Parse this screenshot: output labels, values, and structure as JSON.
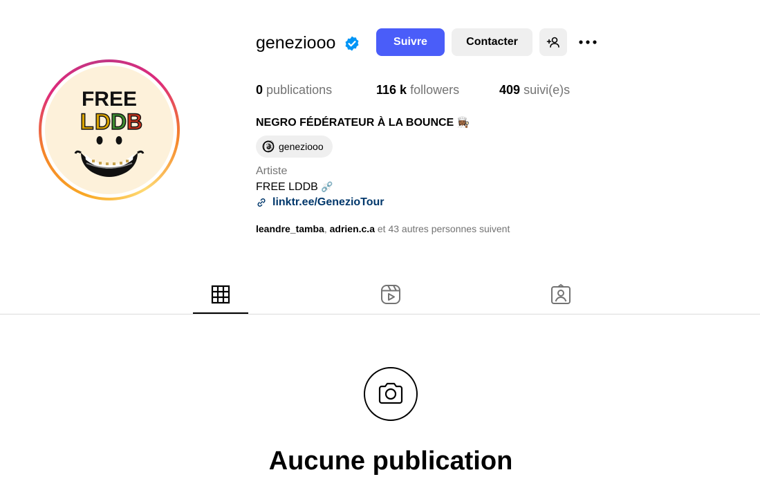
{
  "profile": {
    "username": "geneziooo",
    "follow_label": "Suivre",
    "contact_label": "Contacter",
    "avatar_text_line1": "FREE",
    "avatar_text_line2": "LDDB"
  },
  "stats": {
    "posts_count": "0",
    "posts_label": "publications",
    "followers_count": "116 k",
    "followers_label": "followers",
    "following_count": "409",
    "following_label": "suivi(e)s"
  },
  "bio": {
    "name": "NEGRO FÉDÉRATEUR À LA BOUNCE",
    "threads_handle": "geneziooo",
    "category": "Artiste",
    "line": "FREE LDDB",
    "link": "linktr.ee/GenezioTour"
  },
  "followed_by": {
    "user1": "leandre_tamba",
    "separator": ", ",
    "user2": "adrien.c.a",
    "rest": " et 43 autres personnes suivent"
  },
  "tabs": [
    {
      "name": "posts",
      "icon": "grid-icon",
      "active": true
    },
    {
      "name": "reels",
      "icon": "reels-icon",
      "active": false
    },
    {
      "name": "tagged",
      "icon": "tagged-icon",
      "active": false
    }
  ],
  "empty_state": {
    "title": "Aucune publication",
    "icon": "camera-icon"
  },
  "colors": {
    "accent": "#4a5df9",
    "verified": "#0095f6",
    "link": "#00376b",
    "secondary_text": "#737373",
    "button_bg": "#efefef"
  }
}
